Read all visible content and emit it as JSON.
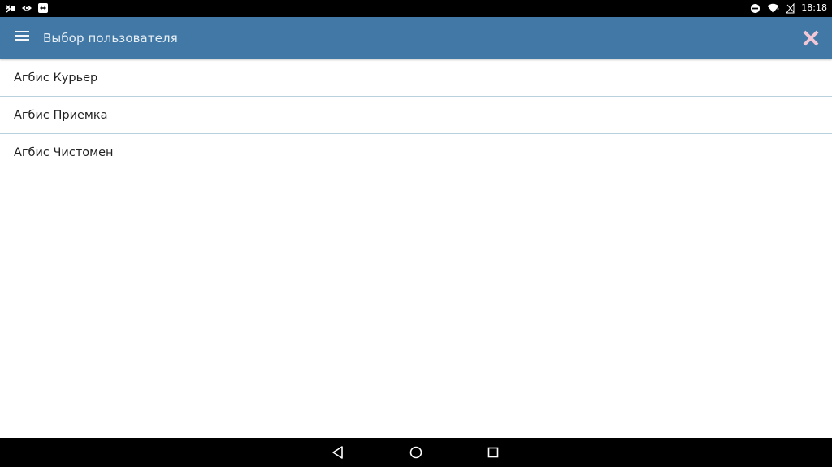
{
  "status_bar": {
    "time": "18:18",
    "left_icons": [
      "no-sim-icon",
      "eye-icon",
      "teamviewer-icon"
    ],
    "right_icons": [
      "do-not-disturb-icon",
      "wifi-icon",
      "no-signal-icon"
    ]
  },
  "app_bar": {
    "title": "Выбор пользователя",
    "background": "#4178a5",
    "close_icon_color": "#f3c6d6"
  },
  "users": {
    "items": [
      {
        "label": "Агбис Курьер"
      },
      {
        "label": "Агбис Приемка"
      },
      {
        "label": "Агбис Чистомен"
      }
    ]
  },
  "nav_bar": {
    "buttons": [
      "back-icon",
      "home-icon",
      "recents-icon"
    ]
  }
}
